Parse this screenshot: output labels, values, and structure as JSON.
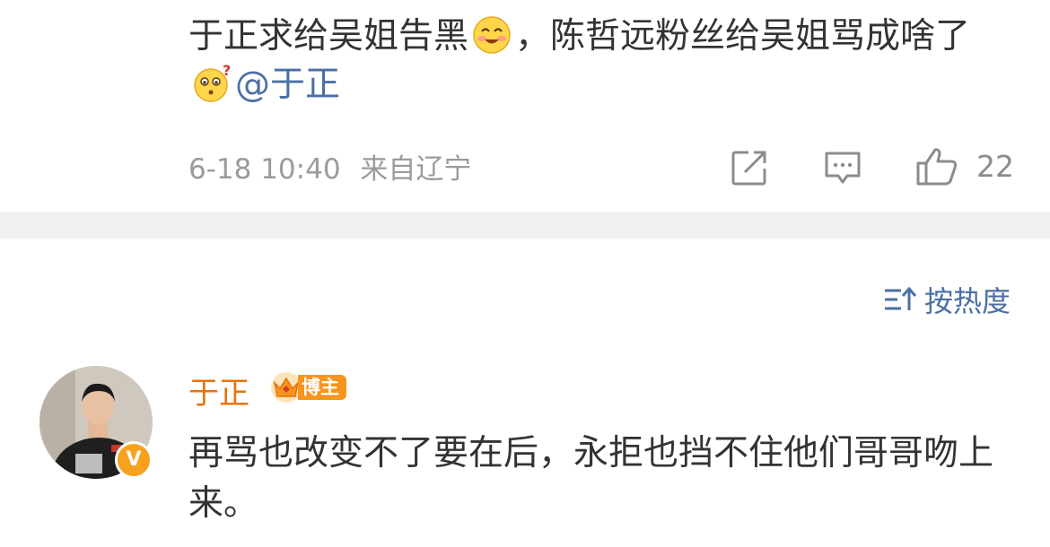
{
  "post": {
    "segments": [
      "于正求给吴姐告黑",
      "，陈哲远粉丝给吴姐骂成啥了",
      "@于正"
    ],
    "emojis": [
      "blush-emoji",
      "confused-emoji"
    ],
    "time": "6-18 10:40",
    "location": "来自辽宁",
    "like_count": "22"
  },
  "sort": {
    "label": "按热度"
  },
  "reply": {
    "username": "于正",
    "badge": "博主",
    "text": "再骂也改变不了要在后，永拒也挡不住他们哥哥吻上来。"
  },
  "colors": {
    "mention": "#4a6fa5",
    "username": "#e8730a",
    "badge": "#f7941d",
    "meta": "#9b9b9b"
  }
}
